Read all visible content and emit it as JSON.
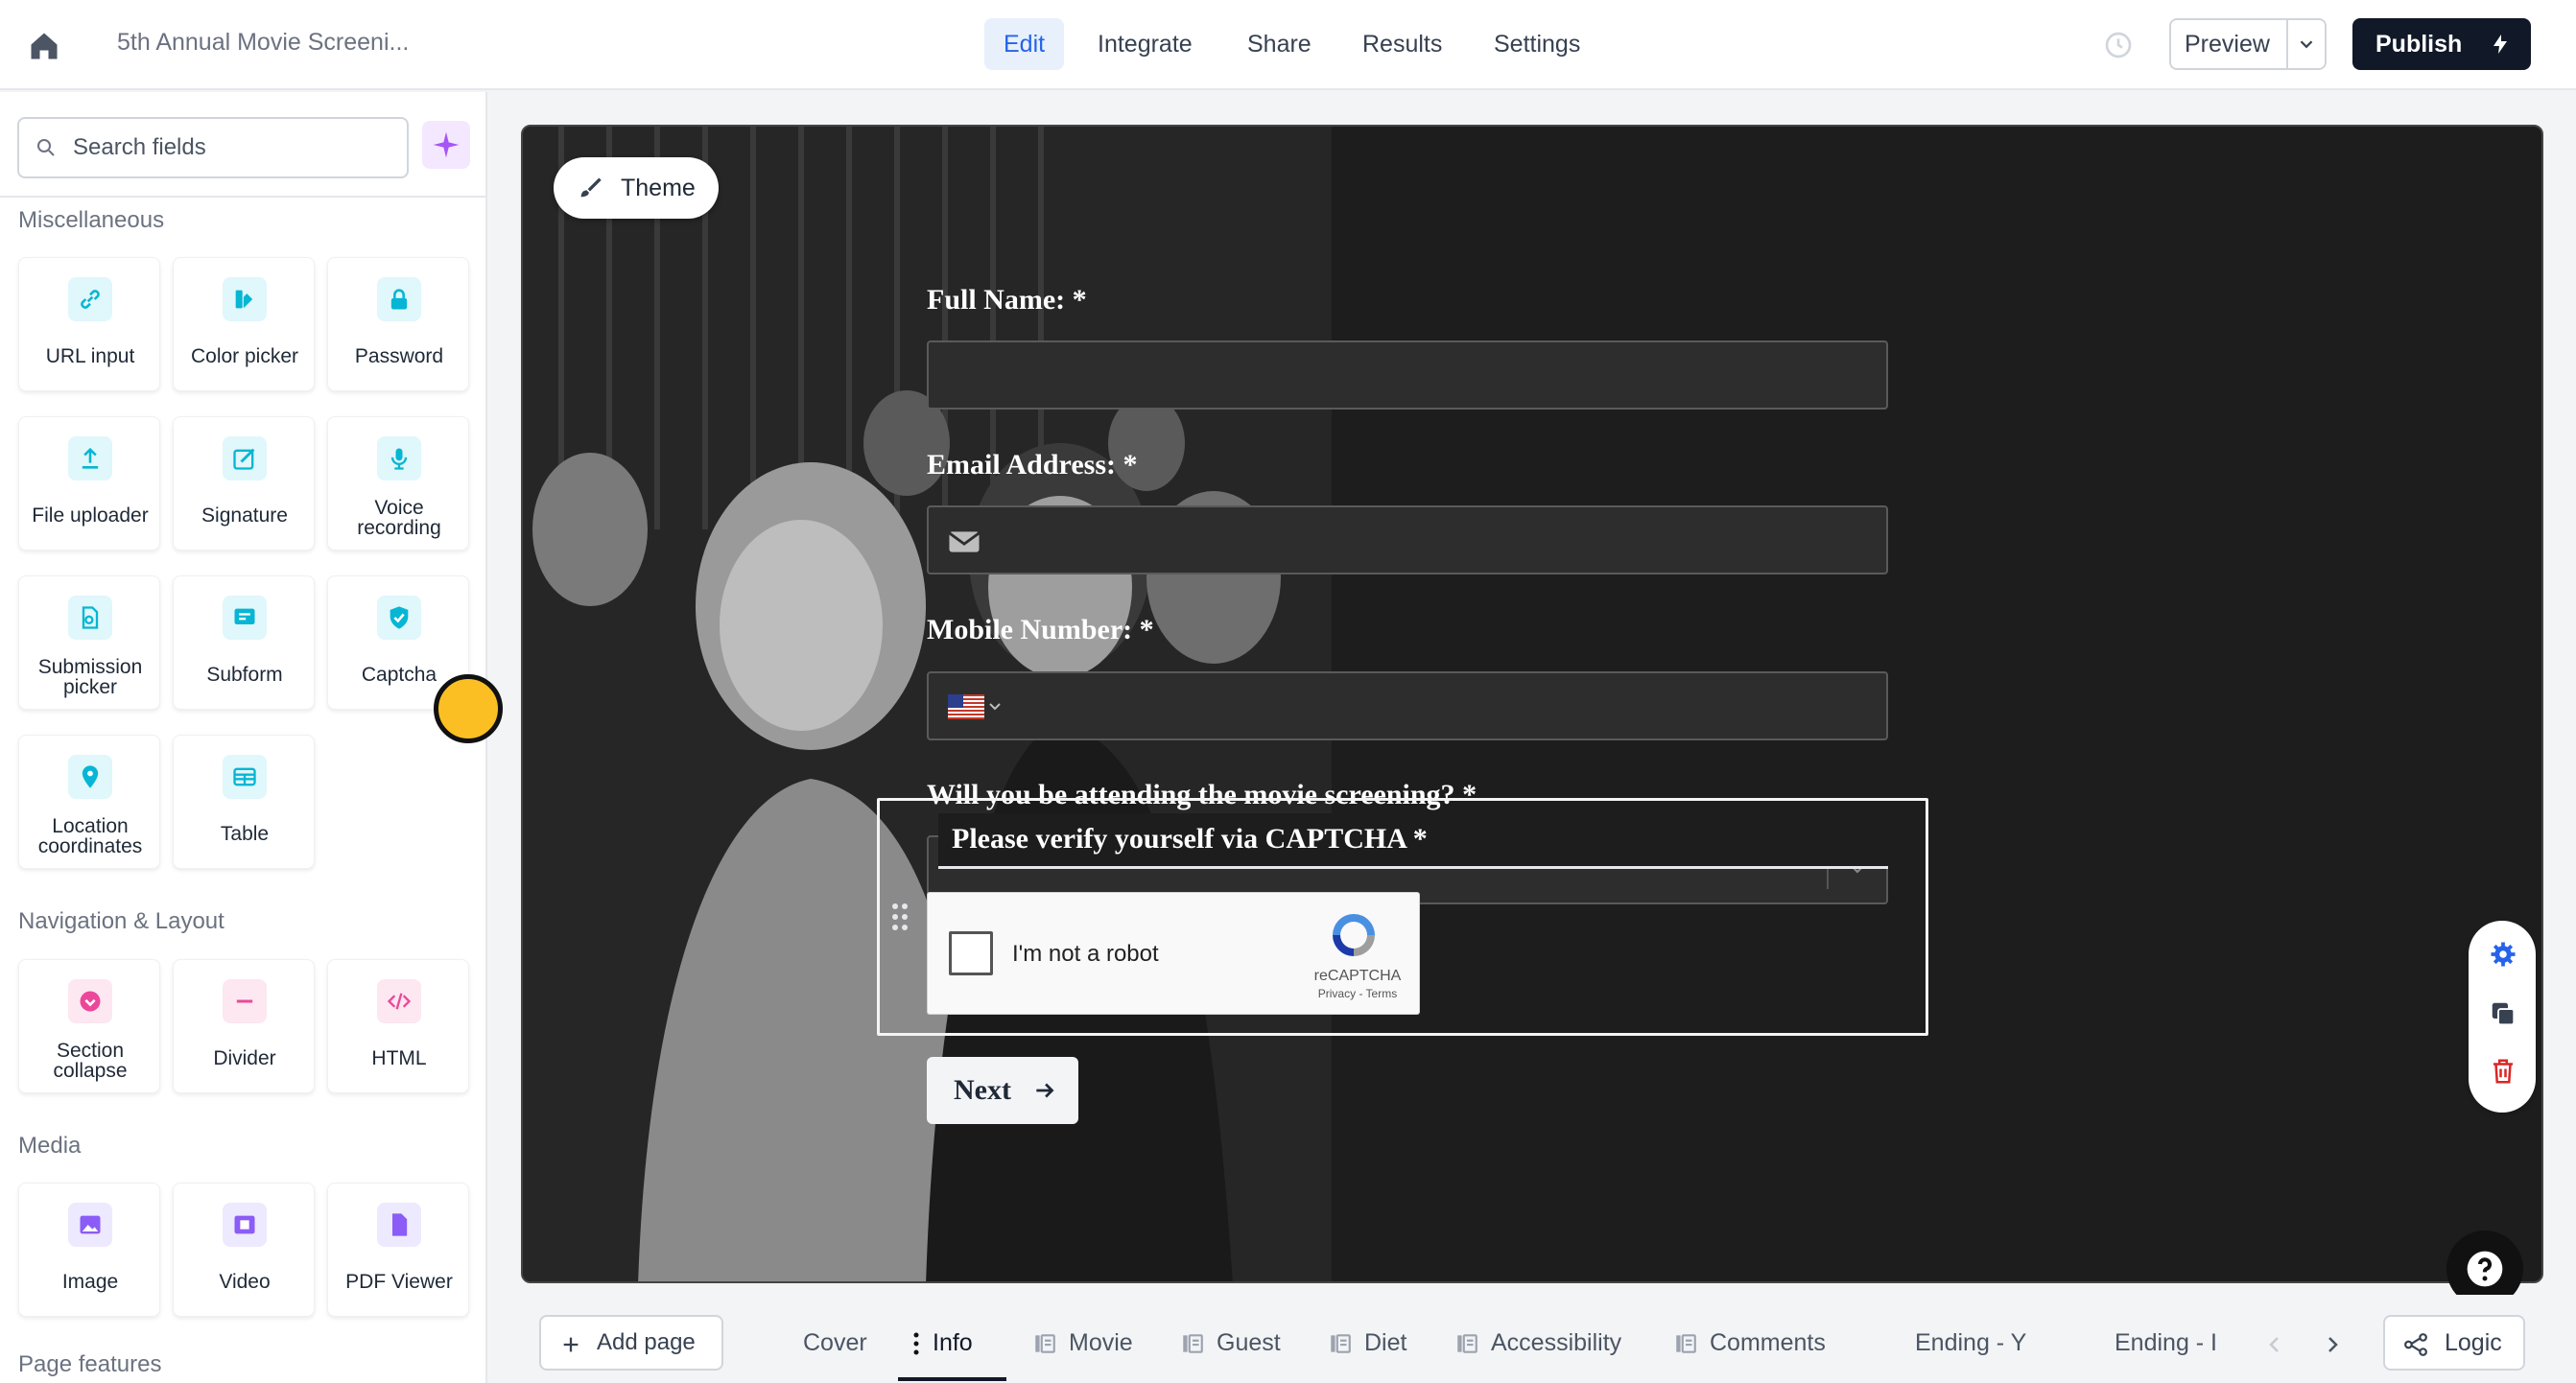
{
  "topbar": {
    "doc_title": "5th Annual Movie Screeni...",
    "tabs": [
      {
        "label": "Edit",
        "active": true
      },
      {
        "label": "Integrate",
        "active": false
      },
      {
        "label": "Share",
        "active": false
      },
      {
        "label": "Results",
        "active": false
      },
      {
        "label": "Settings",
        "active": false
      }
    ],
    "preview_label": "Preview",
    "publish_label": "Publish"
  },
  "sidebar": {
    "search_placeholder": "Search fields",
    "sections": [
      {
        "title": "Miscellaneous"
      },
      {
        "title": "Navigation & Layout"
      },
      {
        "title": "Media"
      },
      {
        "title": "Page features"
      }
    ],
    "misc_items": [
      {
        "label": "URL input",
        "icon": "link-icon"
      },
      {
        "label": "Color picker",
        "icon": "color-picker-icon"
      },
      {
        "label": "Password",
        "icon": "lock-icon"
      },
      {
        "label": "File uploader",
        "icon": "upload-icon"
      },
      {
        "label": "Signature",
        "icon": "signature-icon"
      },
      {
        "label": "Voice recording",
        "icon": "microphone-icon"
      },
      {
        "label": "Submission picker",
        "icon": "submission-picker-icon"
      },
      {
        "label": "Subform",
        "icon": "subform-icon"
      },
      {
        "label": "Captcha",
        "icon": "shield-check-icon"
      },
      {
        "label": "Location coordinates",
        "icon": "location-pin-icon"
      },
      {
        "label": "Table",
        "icon": "table-icon"
      }
    ],
    "nav_items": [
      {
        "label": "Section collapse",
        "icon": "section-collapse-icon"
      },
      {
        "label": "Divider",
        "icon": "divider-icon"
      },
      {
        "label": "HTML",
        "icon": "code-icon"
      }
    ],
    "media_items": [
      {
        "label": "Image",
        "icon": "image-icon"
      },
      {
        "label": "Video",
        "icon": "video-icon"
      },
      {
        "label": "PDF Viewer",
        "icon": "pdf-icon"
      }
    ]
  },
  "canvas": {
    "theme_label": "Theme",
    "fields": [
      {
        "label": "Full Name:",
        "required": "*"
      },
      {
        "label": "Email Address:",
        "required": "*"
      },
      {
        "label": "Mobile Number:",
        "required": "*"
      },
      {
        "label": "Will you be attending the movie screening?",
        "required": "*"
      }
    ],
    "captcha_title": "Please verify yourself via CAPTCHA *",
    "recaptcha_text": "I'm not a robot",
    "recaptcha_brand": "reCAPTCHA",
    "recaptcha_terms": "Privacy - Terms",
    "next_label": "Next"
  },
  "bottombar": {
    "add_page_label": "Add page",
    "pages": [
      {
        "label": "Cover",
        "active": false
      },
      {
        "label": "Info",
        "active": true
      },
      {
        "label": "Movie",
        "active": false
      },
      {
        "label": "Guest",
        "active": false
      },
      {
        "label": "Diet",
        "active": false
      },
      {
        "label": "Accessibility",
        "active": false
      },
      {
        "label": "Comments",
        "active": false
      },
      {
        "label": "Ending - Y",
        "active": false
      },
      {
        "label": "Ending - I",
        "active": false
      }
    ],
    "logic_label": "Logic"
  },
  "colors": {
    "accent": "#2563eb",
    "publish_bg": "#111827",
    "tile_icon_bg": "#e0f7fb",
    "tile_icon_fg": "#06b6d4",
    "canvas_bg": "#1d1d1d",
    "cursor_marker": "#fbbf24"
  }
}
